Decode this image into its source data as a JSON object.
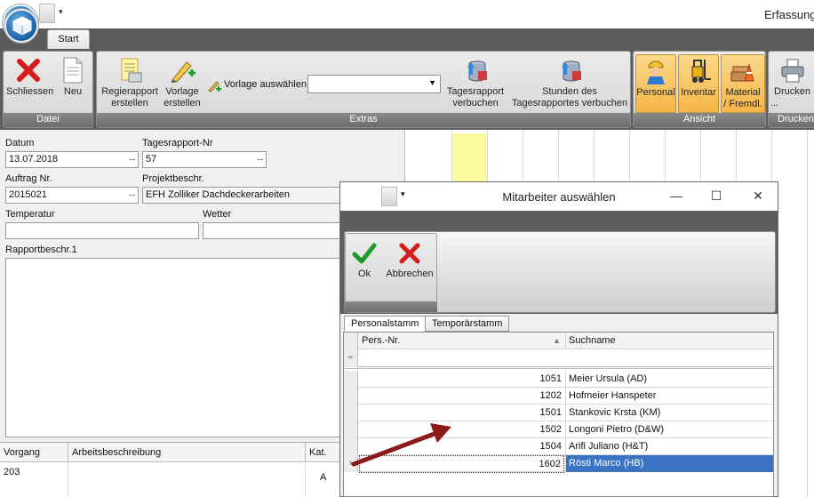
{
  "app": {
    "title": "Erfassung"
  },
  "tabs": {
    "start": "Start"
  },
  "ribbon": {
    "datei": {
      "label": "Datei",
      "schliessen": "Schliessen",
      "neu": "Neu"
    },
    "extras": {
      "label": "Extras",
      "regierapport_1": "Regierapport",
      "regierapport_2": "erstellen",
      "vorlage_1": "Vorlage",
      "vorlage_2": "erstellen",
      "vorlage_auswaehlen": "Vorlage auswählen",
      "tagesrapport_1": "Tagesrapport",
      "tagesrapport_2": "verbuchen",
      "stunden_1": "Stunden des",
      "stunden_2": "Tagesrapportes verbuchen"
    },
    "ansicht": {
      "label": "Ansicht",
      "personal": "Personal",
      "inventar": "Inventar",
      "material_1": "Material",
      "material_2": "/ Fremdl."
    },
    "drucken": {
      "label": "Drucken",
      "drucken_btn": "Drucken ..."
    }
  },
  "form": {
    "datum_label": "Datum",
    "datum_value": "13.07.2018",
    "tagesrapport_label": "Tagesrapport-Nr",
    "tagesrapport_value": "57",
    "auftrag_label": "Auftrag Nr.",
    "auftrag_value": "2015021",
    "projekt_label": "Projektbeschr.",
    "projekt_value": "EFH Zolliker Dachdeckerarbeiten",
    "temperatur_label": "Temperatur",
    "temperatur_value": "",
    "wetter_label": "Wetter",
    "wetter_value": "",
    "rapport_label": "Rapportbeschr.1",
    "ellipsis": "···"
  },
  "bottom_grid": {
    "headers": [
      "Vorgang",
      "Arbeitsbeschreibung",
      "Kat."
    ],
    "row": {
      "vorgang": "203",
      "arbeit": "",
      "kat": "A"
    }
  },
  "dialog": {
    "title": "Mitarbeiter auswählen",
    "ok": "Ok",
    "abbrechen": "Abbrechen",
    "tabs": [
      "Personalstamm",
      "Temporärstamm"
    ],
    "columns": {
      "nr": "Pers.-Nr.",
      "name": "Suchname"
    },
    "rows": [
      {
        "nr": "1051",
        "name": "Meier Ursula (AD)"
      },
      {
        "nr": "1202",
        "name": "Hofmeier Hanspeter"
      },
      {
        "nr": "1501",
        "name": "Stankovic Krsta (KM)"
      },
      {
        "nr": "1502",
        "name": "Longoni Pietro (D&W)"
      },
      {
        "nr": "1504",
        "name": "Arifi Juliano (H&T)"
      },
      {
        "nr": "1602",
        "name": "Rösti Marco (HB)"
      }
    ],
    "selected_index": 5
  },
  "colors": {
    "accent": "#3a72c4",
    "arrow": "#8b1a1a",
    "active_button": "#f6b648"
  },
  "icons": [
    "app-orb-icon",
    "close-x-icon",
    "new-document-icon",
    "report-icon",
    "pencil-plus-icon",
    "database-icon",
    "worker-icon",
    "forklift-icon",
    "material-icon",
    "printer-icon",
    "checkmark-icon",
    "cancel-x-icon",
    "minimize-icon",
    "maximize-icon",
    "close-icon",
    "filter-icon",
    "sort-arrow-icon",
    "annotation-arrow"
  ]
}
